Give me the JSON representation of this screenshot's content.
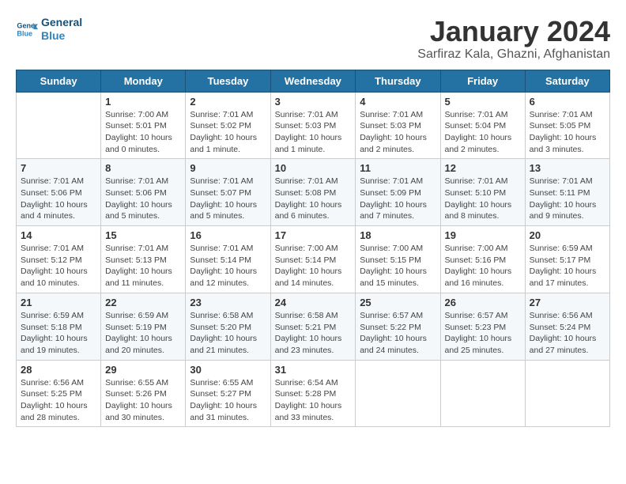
{
  "header": {
    "logo_line1": "General",
    "logo_line2": "Blue",
    "title": "January 2024",
    "subtitle": "Sarfiraz Kala, Ghazni, Afghanistan"
  },
  "weekdays": [
    "Sunday",
    "Monday",
    "Tuesday",
    "Wednesday",
    "Thursday",
    "Friday",
    "Saturday"
  ],
  "weeks": [
    [
      {
        "day": "",
        "info": ""
      },
      {
        "day": "1",
        "info": "Sunrise: 7:00 AM\nSunset: 5:01 PM\nDaylight: 10 hours\nand 0 minutes."
      },
      {
        "day": "2",
        "info": "Sunrise: 7:01 AM\nSunset: 5:02 PM\nDaylight: 10 hours\nand 1 minute."
      },
      {
        "day": "3",
        "info": "Sunrise: 7:01 AM\nSunset: 5:03 PM\nDaylight: 10 hours\nand 1 minute."
      },
      {
        "day": "4",
        "info": "Sunrise: 7:01 AM\nSunset: 5:03 PM\nDaylight: 10 hours\nand 2 minutes."
      },
      {
        "day": "5",
        "info": "Sunrise: 7:01 AM\nSunset: 5:04 PM\nDaylight: 10 hours\nand 2 minutes."
      },
      {
        "day": "6",
        "info": "Sunrise: 7:01 AM\nSunset: 5:05 PM\nDaylight: 10 hours\nand 3 minutes."
      }
    ],
    [
      {
        "day": "7",
        "info": "Sunrise: 7:01 AM\nSunset: 5:06 PM\nDaylight: 10 hours\nand 4 minutes."
      },
      {
        "day": "8",
        "info": "Sunrise: 7:01 AM\nSunset: 5:06 PM\nDaylight: 10 hours\nand 5 minutes."
      },
      {
        "day": "9",
        "info": "Sunrise: 7:01 AM\nSunset: 5:07 PM\nDaylight: 10 hours\nand 5 minutes."
      },
      {
        "day": "10",
        "info": "Sunrise: 7:01 AM\nSunset: 5:08 PM\nDaylight: 10 hours\nand 6 minutes."
      },
      {
        "day": "11",
        "info": "Sunrise: 7:01 AM\nSunset: 5:09 PM\nDaylight: 10 hours\nand 7 minutes."
      },
      {
        "day": "12",
        "info": "Sunrise: 7:01 AM\nSunset: 5:10 PM\nDaylight: 10 hours\nand 8 minutes."
      },
      {
        "day": "13",
        "info": "Sunrise: 7:01 AM\nSunset: 5:11 PM\nDaylight: 10 hours\nand 9 minutes."
      }
    ],
    [
      {
        "day": "14",
        "info": "Sunrise: 7:01 AM\nSunset: 5:12 PM\nDaylight: 10 hours\nand 10 minutes."
      },
      {
        "day": "15",
        "info": "Sunrise: 7:01 AM\nSunset: 5:13 PM\nDaylight: 10 hours\nand 11 minutes."
      },
      {
        "day": "16",
        "info": "Sunrise: 7:01 AM\nSunset: 5:14 PM\nDaylight: 10 hours\nand 12 minutes."
      },
      {
        "day": "17",
        "info": "Sunrise: 7:00 AM\nSunset: 5:14 PM\nDaylight: 10 hours\nand 14 minutes."
      },
      {
        "day": "18",
        "info": "Sunrise: 7:00 AM\nSunset: 5:15 PM\nDaylight: 10 hours\nand 15 minutes."
      },
      {
        "day": "19",
        "info": "Sunrise: 7:00 AM\nSunset: 5:16 PM\nDaylight: 10 hours\nand 16 minutes."
      },
      {
        "day": "20",
        "info": "Sunrise: 6:59 AM\nSunset: 5:17 PM\nDaylight: 10 hours\nand 17 minutes."
      }
    ],
    [
      {
        "day": "21",
        "info": "Sunrise: 6:59 AM\nSunset: 5:18 PM\nDaylight: 10 hours\nand 19 minutes."
      },
      {
        "day": "22",
        "info": "Sunrise: 6:59 AM\nSunset: 5:19 PM\nDaylight: 10 hours\nand 20 minutes."
      },
      {
        "day": "23",
        "info": "Sunrise: 6:58 AM\nSunset: 5:20 PM\nDaylight: 10 hours\nand 21 minutes."
      },
      {
        "day": "24",
        "info": "Sunrise: 6:58 AM\nSunset: 5:21 PM\nDaylight: 10 hours\nand 23 minutes."
      },
      {
        "day": "25",
        "info": "Sunrise: 6:57 AM\nSunset: 5:22 PM\nDaylight: 10 hours\nand 24 minutes."
      },
      {
        "day": "26",
        "info": "Sunrise: 6:57 AM\nSunset: 5:23 PM\nDaylight: 10 hours\nand 25 minutes."
      },
      {
        "day": "27",
        "info": "Sunrise: 6:56 AM\nSunset: 5:24 PM\nDaylight: 10 hours\nand 27 minutes."
      }
    ],
    [
      {
        "day": "28",
        "info": "Sunrise: 6:56 AM\nSunset: 5:25 PM\nDaylight: 10 hours\nand 28 minutes."
      },
      {
        "day": "29",
        "info": "Sunrise: 6:55 AM\nSunset: 5:26 PM\nDaylight: 10 hours\nand 30 minutes."
      },
      {
        "day": "30",
        "info": "Sunrise: 6:55 AM\nSunset: 5:27 PM\nDaylight: 10 hours\nand 31 minutes."
      },
      {
        "day": "31",
        "info": "Sunrise: 6:54 AM\nSunset: 5:28 PM\nDaylight: 10 hours\nand 33 minutes."
      },
      {
        "day": "",
        "info": ""
      },
      {
        "day": "",
        "info": ""
      },
      {
        "day": "",
        "info": ""
      }
    ]
  ]
}
